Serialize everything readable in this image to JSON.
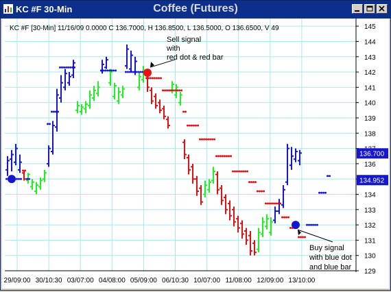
{
  "window": {
    "caption": "KC #F 30-Min",
    "title": "Coffee (Futures)",
    "app_icon": "chart-icon",
    "controls": [
      "minimize-icon",
      "maximize-icon",
      "close-icon"
    ]
  },
  "info_line": "KC #F [30-Min] 11/16/09 0.0000 C 136.7000, H 136.8500, L 136.5000, O 136.6500, V 49",
  "annotations": {
    "sell": [
      "Sell signal",
      "with",
      "red dot & red bar"
    ],
    "buy": [
      "Buy signal",
      "with blue dot",
      "and blue bar"
    ]
  },
  "price_labels": {
    "last": "136.700",
    "stop": "134.952"
  },
  "colors": {
    "up": "#22ee22",
    "down": "#dd1111",
    "blue": "#1616cc",
    "grid": "#a8e8e8",
    "highlight": "#1616cc"
  },
  "chart_data": {
    "type": "bar",
    "ylim": [
      129,
      145.5
    ],
    "y_ticks": [
      "129",
      "130",
      "131",
      "132",
      "133",
      "134",
      "135",
      "136",
      "137",
      "138",
      "139",
      "140",
      "141",
      "142",
      "143",
      "144",
      "145"
    ],
    "x_ticks": [
      "29/09:00",
      "30/10:30",
      "03/07:00",
      "04/08:00",
      "05/09:00",
      "06/10:30",
      "10/07:00",
      "11/08:00",
      "12/09:00",
      "13/10:00"
    ],
    "bars": [
      [
        "b",
        135.2,
        136.5,
        135.6,
        136.2
      ],
      [
        "b",
        135.5,
        136.9,
        136.3,
        136.6
      ],
      [
        "b",
        135.9,
        137.3,
        136.1,
        137.0
      ],
      [
        "b",
        135.4,
        136.6,
        135.6,
        136.1
      ],
      [
        "r",
        134.9,
        135.5,
        135.4,
        135.0
      ],
      [
        "g",
        134.7,
        135.4,
        134.9,
        135.3
      ],
      [
        "g",
        134.3,
        135.0,
        134.5,
        134.8
      ],
      [
        "g",
        134.0,
        134.8,
        134.2,
        134.6
      ],
      [
        "g",
        134.3,
        135.1,
        134.5,
        134.9
      ],
      [
        "g",
        134.8,
        135.6,
        135.0,
        135.4
      ],
      [
        "b",
        135.8,
        137.2,
        136.0,
        137.0
      ],
      [
        "b",
        136.6,
        138.8,
        136.8,
        138.5
      ],
      [
        "b",
        138.1,
        140.9,
        138.4,
        140.5
      ],
      [
        "b",
        140.0,
        141.8,
        140.3,
        141.3
      ],
      [
        "b",
        140.8,
        142.2,
        141.0,
        141.9
      ],
      [
        "b",
        141.1,
        142.0,
        141.3,
        141.7
      ],
      [
        "b",
        141.6,
        142.8,
        141.8,
        142.6
      ],
      [
        "g",
        139.3,
        140.1,
        139.5,
        139.8
      ],
      [
        "g",
        139.2,
        139.9,
        139.4,
        139.7
      ],
      [
        "g",
        139.3,
        140.1,
        139.6,
        139.9
      ],
      [
        "g",
        139.6,
        140.8,
        139.8,
        140.5
      ],
      [
        "g",
        140.1,
        141.1,
        140.3,
        140.8
      ],
      [
        "g",
        140.4,
        141.4,
        140.6,
        141.0
      ],
      [
        "b",
        141.9,
        142.8,
        142.1,
        142.5
      ],
      [
        "b",
        142.2,
        143.0,
        142.3,
        142.8
      ],
      [
        "g",
        141.1,
        142.2,
        141.3,
        142.0
      ],
      [
        "g",
        140.2,
        141.3,
        140.4,
        141.1
      ],
      [
        "g",
        139.9,
        141.0,
        140.1,
        140.7
      ],
      [
        "g",
        140.3,
        141.1,
        140.5,
        140.9
      ],
      [
        "b",
        142.2,
        143.8,
        142.4,
        143.5
      ],
      [
        "b",
        142.0,
        143.4,
        142.2,
        143.1
      ],
      [
        "b",
        141.8,
        143.0,
        142.0,
        142.7
      ],
      [
        "g",
        140.8,
        142.0,
        141.0,
        141.7
      ],
      [
        "g",
        141.3,
        142.4,
        141.5,
        142.1
      ],
      [
        "r",
        140.7,
        142.2,
        141.9,
        141.0
      ],
      [
        "r",
        139.9,
        141.0,
        140.8,
        140.1
      ],
      [
        "r",
        139.6,
        140.6,
        140.4,
        139.8
      ],
      [
        "r",
        139.3,
        140.2,
        140.0,
        139.5
      ],
      [
        "r",
        138.9,
        139.8,
        139.6,
        139.1
      ],
      [
        "r",
        138.3,
        139.1,
        138.9,
        138.5
      ],
      [
        "g",
        140.6,
        141.4,
        140.8,
        141.2
      ],
      [
        "g",
        140.3,
        141.2,
        140.5,
        141.0
      ],
      [
        "g",
        139.8,
        140.7,
        140.0,
        140.5
      ],
      [
        "r",
        136.3,
        137.6,
        137.4,
        136.6
      ],
      [
        "r",
        135.3,
        136.6,
        136.4,
        135.6
      ],
      [
        "r",
        134.7,
        136.0,
        135.8,
        135.0
      ],
      [
        "r",
        133.9,
        135.2,
        135.0,
        134.2
      ],
      [
        "r",
        133.3,
        134.6,
        134.4,
        133.5
      ],
      [
        "g",
        133.8,
        134.9,
        134.0,
        134.6
      ],
      [
        "g",
        134.1,
        135.0,
        134.3,
        134.8
      ],
      [
        "g",
        134.7,
        135.8,
        134.9,
        135.5
      ],
      [
        "r",
        134.0,
        135.5,
        135.3,
        134.3
      ],
      [
        "r",
        133.3,
        134.6,
        134.4,
        133.6
      ],
      [
        "r",
        132.7,
        134.0,
        133.8,
        133.0
      ],
      [
        "r",
        132.3,
        133.6,
        133.4,
        132.6
      ],
      [
        "r",
        131.9,
        133.2,
        133.0,
        132.2
      ],
      [
        "r",
        131.5,
        132.6,
        132.4,
        131.8
      ],
      [
        "r",
        131.1,
        132.3,
        132.1,
        131.4
      ],
      [
        "r",
        130.7,
        131.8,
        131.6,
        131.0
      ],
      [
        "r",
        130.0,
        131.6,
        131.3,
        130.3
      ],
      [
        "r",
        130.0,
        131.0,
        130.8,
        130.2
      ],
      [
        "g",
        130.2,
        131.8,
        130.4,
        131.5
      ],
      [
        "g",
        131.2,
        132.5,
        131.4,
        132.2
      ],
      [
        "g",
        131.7,
        132.7,
        131.9,
        132.4
      ],
      [
        "g",
        131.3,
        132.5,
        131.5,
        132.2
      ],
      [
        "b",
        132.1,
        133.2,
        132.3,
        132.9
      ],
      [
        "b",
        132.7,
        133.7,
        132.9,
        133.4
      ],
      [
        "b",
        133.1,
        134.6,
        133.3,
        134.3
      ],
      [
        "b",
        134.6,
        137.3,
        134.8,
        137.0
      ],
      [
        "b",
        135.6,
        137.1,
        135.9,
        136.5
      ],
      [
        "b",
        136.1,
        137.0,
        136.3,
        136.8
      ],
      [
        "b",
        135.9,
        136.9,
        136.2,
        136.7
      ]
    ],
    "stops": [
      [
        "b",
        135.0,
        0,
        3
      ],
      [
        "r",
        135.55,
        4,
        4
      ],
      [
        "b",
        135.0,
        5,
        5
      ],
      [
        "b",
        138.6,
        10,
        10
      ],
      [
        "b",
        139.4,
        11,
        12
      ],
      [
        "b",
        142.3,
        13,
        16
      ],
      [
        "b",
        142.1,
        23,
        26
      ],
      [
        "b",
        142.0,
        29,
        33
      ],
      [
        "r",
        141.6,
        34,
        37
      ],
      [
        "r",
        140.8,
        38,
        42
      ],
      [
        "r",
        139.4,
        43,
        43
      ],
      [
        "r",
        138.5,
        44,
        46
      ],
      [
        "r",
        137.6,
        47,
        50
      ],
      [
        "r",
        136.5,
        51,
        54
      ],
      [
        "r",
        135.5,
        55,
        58
      ],
      [
        "r",
        134.8,
        59,
        60
      ],
      [
        "r",
        134.2,
        61,
        62
      ],
      [
        "r",
        133.4,
        63,
        66
      ],
      [
        "r",
        132.5,
        67,
        68
      ],
      [
        "r",
        131.8,
        69,
        70
      ],
      [
        "r",
        131.2,
        71,
        72
      ],
      [
        "b",
        132.0,
        73,
        75
      ],
      [
        "b",
        134.1,
        76,
        77
      ],
      [
        "b",
        135.2,
        78,
        78
      ]
    ],
    "signals": [
      {
        "kind": "buy",
        "bar": 1,
        "price": 135.0,
        "color": "#1616cc"
      },
      {
        "kind": "sell",
        "bar": 34,
        "price": 141.95,
        "color": "#ee1111"
      },
      {
        "kind": "buy",
        "bar": 70,
        "price": 132.0,
        "color": "#1616cc"
      }
    ]
  }
}
